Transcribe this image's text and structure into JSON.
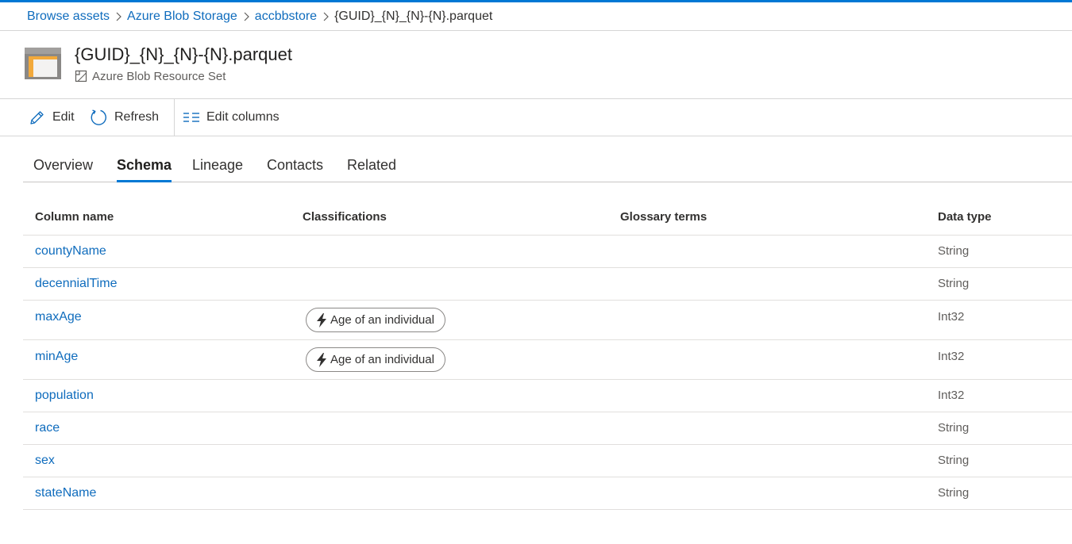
{
  "breadcrumb": {
    "items": [
      "Browse assets",
      "Azure Blob Storage",
      "accbbstore"
    ],
    "current": "{GUID}_{N}_{N}-{N}.parquet"
  },
  "asset": {
    "title": "{GUID}_{N}_{N}-{N}.parquet",
    "type_label": "Azure Blob Resource Set",
    "icon": "folder-icon"
  },
  "toolbar": {
    "edit_label": "Edit",
    "refresh_label": "Refresh",
    "edit_columns_label": "Edit columns"
  },
  "tabs": [
    "Overview",
    "Schema",
    "Lineage",
    "Contacts",
    "Related"
  ],
  "active_tab": "Schema",
  "schema": {
    "headers": {
      "column_name": "Column name",
      "classifications": "Classifications",
      "glossary_terms": "Glossary terms",
      "data_type": "Data type"
    },
    "rows": [
      {
        "name": "countyName",
        "classification": "",
        "glossary": "",
        "type": "String"
      },
      {
        "name": "decennialTime",
        "classification": "",
        "glossary": "",
        "type": "String"
      },
      {
        "name": "maxAge",
        "classification": "Age of an individual",
        "glossary": "",
        "type": "Int32"
      },
      {
        "name": "minAge",
        "classification": "Age of an individual",
        "glossary": "",
        "type": "Int32"
      },
      {
        "name": "population",
        "classification": "",
        "glossary": "",
        "type": "Int32"
      },
      {
        "name": "race",
        "classification": "",
        "glossary": "",
        "type": "String"
      },
      {
        "name": "sex",
        "classification": "",
        "glossary": "",
        "type": "String"
      },
      {
        "name": "stateName",
        "classification": "",
        "glossary": "",
        "type": "String"
      }
    ]
  },
  "colors": {
    "accent": "#0078d4",
    "link": "#0f6cbd",
    "text": "#323130",
    "muted": "#605e5c"
  }
}
